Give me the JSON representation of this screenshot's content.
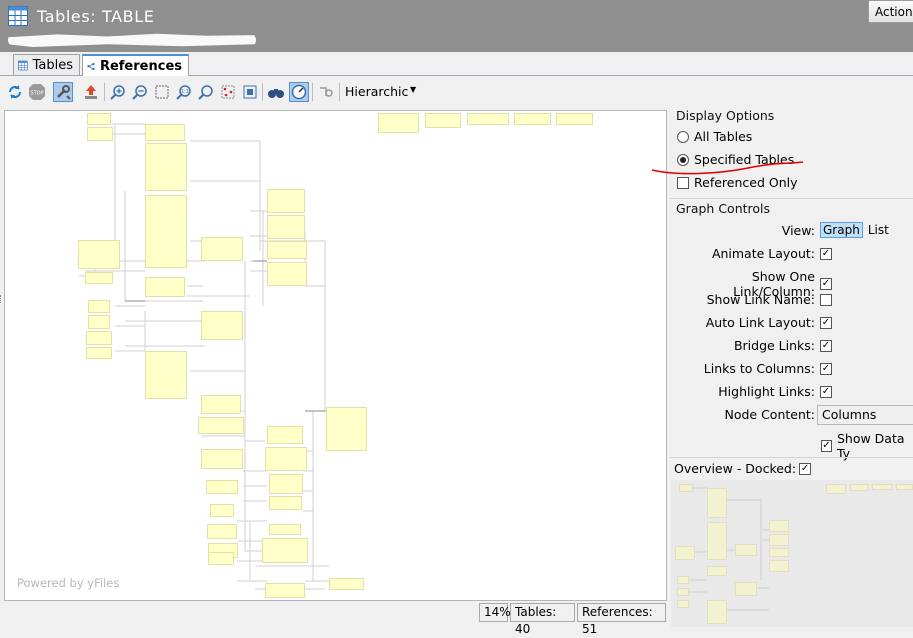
{
  "window": {
    "title": "Tables: TABLE",
    "actions_label": "Actions",
    "icon": "table-grid-icon"
  },
  "tabs": [
    {
      "label": "Tables",
      "icon": "table-grid-icon",
      "active": false
    },
    {
      "label": "References",
      "icon": "references-graph-icon",
      "active": true
    }
  ],
  "toolbar": {
    "buttons": [
      {
        "name": "refresh-icon"
      },
      {
        "name": "stop-icon"
      },
      {
        "name": "tools-icon",
        "pressed": true
      },
      {
        "name": "export-icon"
      },
      {
        "name": "zoom-in-icon"
      },
      {
        "name": "zoom-out-icon"
      },
      {
        "name": "fit-selection-icon"
      },
      {
        "name": "zoom-100-icon"
      },
      {
        "name": "zoom-fit-icon"
      },
      {
        "name": "select-nodes-icon"
      },
      {
        "name": "center-icon"
      },
      {
        "name": "binoculars-icon"
      },
      {
        "name": "navigate-icon",
        "pressed": true
      },
      {
        "name": "link-settings-icon"
      }
    ],
    "layout_label": "Hierarchic"
  },
  "canvas": {
    "powered_by": "Powered by yFiles",
    "node_color": "#ffffc8"
  },
  "status": {
    "zoom": "14%",
    "tables": "Tables: 40",
    "references": "References: 51"
  },
  "display_options": {
    "title": "Display Options",
    "options": [
      {
        "label": "All Tables",
        "type": "radio",
        "checked": false
      },
      {
        "label": "Specified Tables",
        "type": "radio",
        "checked": true
      },
      {
        "label": "Referenced Only",
        "type": "checkbox",
        "checked": false
      }
    ]
  },
  "graph_controls": {
    "title": "Graph Controls",
    "view_label": "View:",
    "view_graph": "Graph",
    "view_list": "List",
    "rows": [
      {
        "label": "Animate Layout:",
        "checked": true
      },
      {
        "label": "Show One Link/Column:",
        "checked": true
      },
      {
        "label": "Show Link Name:",
        "checked": false
      },
      {
        "label": "Auto Link Layout:",
        "checked": true
      },
      {
        "label": "Bridge Links:",
        "checked": true
      },
      {
        "label": "Links to Columns:",
        "checked": true
      },
      {
        "label": "Highlight Links:",
        "checked": true
      }
    ],
    "node_content_label": "Node Content:",
    "node_content_value": "Columns",
    "show_data_types": "Show Data Ty",
    "show_data_types_checked": true
  },
  "overview": {
    "label": "Overview - Docked:",
    "checked": true
  },
  "colors": {
    "titlebar": "#8f8f8f",
    "annotation_red": "#e00000",
    "selected_view": "#bfe0f7"
  }
}
